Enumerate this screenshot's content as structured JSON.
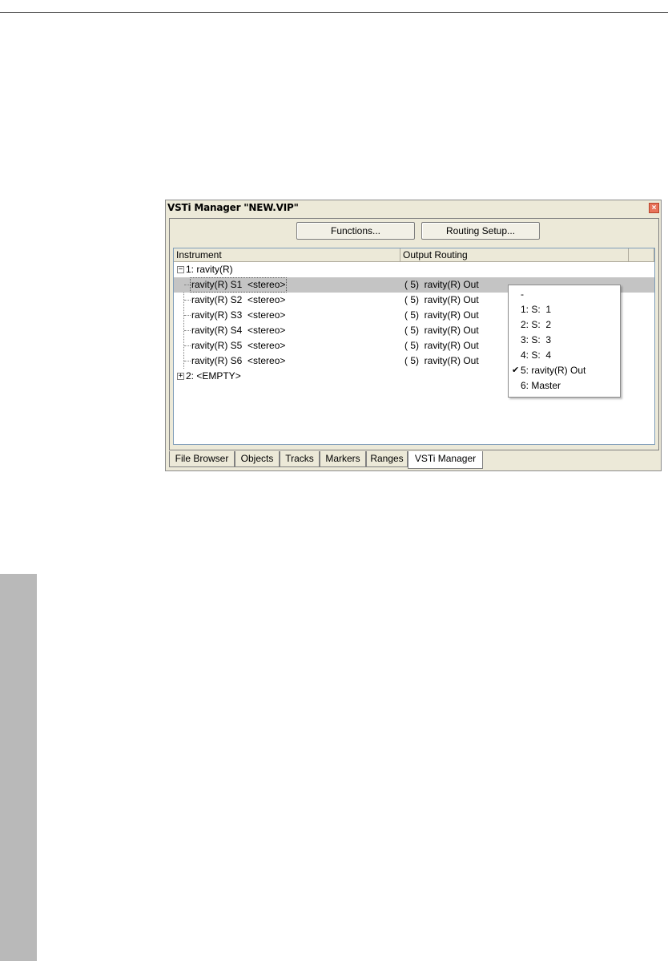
{
  "window": {
    "title": "VSTi Manager  \"NEW.VIP\"",
    "close_glyph": "×"
  },
  "toolbar": {
    "functions_label": "Functions...",
    "routing_label": "Routing Setup..."
  },
  "columns": {
    "instrument": "Instrument",
    "output": "Output Routing"
  },
  "tree": {
    "root1": {
      "expander": "−",
      "label": "1: ravity(R)"
    },
    "children": [
      {
        "label": "ravity(R) S1  <stereo>",
        "output": "( 5)  ravity(R) Out",
        "selected": true
      },
      {
        "label": "ravity(R) S2  <stereo>",
        "output": "( 5)  ravity(R) Out"
      },
      {
        "label": "ravity(R) S3  <stereo>",
        "output": "( 5)  ravity(R) Out"
      },
      {
        "label": "ravity(R) S4  <stereo>",
        "output": "( 5)  ravity(R) Out"
      },
      {
        "label": "ravity(R) S5  <stereo>",
        "output": "( 5)  ravity(R) Out"
      },
      {
        "label": "ravity(R) S6  <stereo>",
        "output": "( 5)  ravity(R) Out"
      }
    ],
    "root2": {
      "expander": "+",
      "label": "2: <EMPTY>"
    }
  },
  "routing_menu": {
    "items": [
      {
        "label": "-"
      },
      {
        "label": "1: S:  1"
      },
      {
        "label": "2: S:  2"
      },
      {
        "label": "3: S:  3"
      },
      {
        "label": "4: S:  4"
      },
      {
        "label": "5: ravity(R) Out",
        "checked": true,
        "check_glyph": "✔"
      },
      {
        "label": "6: Master"
      }
    ]
  },
  "tabs": [
    {
      "label": "File Browser"
    },
    {
      "label": "Objects"
    },
    {
      "label": "Tracks"
    },
    {
      "label": "Markers"
    },
    {
      "label": "Ranges"
    },
    {
      "label": "VSTi Manager",
      "active": true
    }
  ]
}
